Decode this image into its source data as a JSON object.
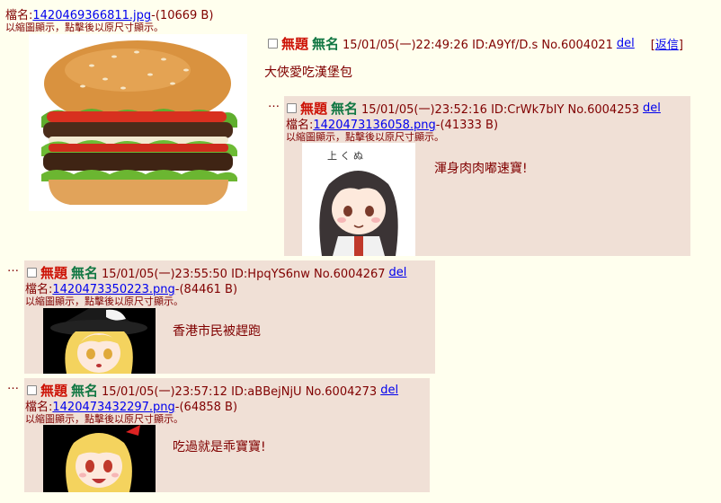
{
  "op": {
    "file_label": "檔名:",
    "file_name": "1420469366811.jpg",
    "file_size": "-(10669 B)",
    "hint": "以縮圖顯示，點擊後以原尺寸顯示。",
    "title": "無題",
    "name": "無名",
    "meta": "15/01/05(一)22:49:26 ID:A9Yf/D.s No.6004021",
    "del": "del",
    "reply_link": "返信",
    "reply_bracket_open": "[",
    "reply_bracket_close": "]",
    "body": "大俠愛吃漢堡包",
    "thumb_icon": "hamburger-image"
  },
  "replies": [
    {
      "dots": "…",
      "title": "無題",
      "name": "無名",
      "meta": "15/01/05(一)23:52:16 ID:CrWk7bIY No.6004253",
      "del": "del",
      "file_label": "檔名:",
      "file_name": "1420473136058.png",
      "file_size": "-(41333 B)",
      "hint": "以縮圖顯示，點擊後以原尺寸顯示。",
      "body": "渾身肉肉嘟速寶!",
      "thumb_caption": "上 く ぬ",
      "thumb_icon": "anime-girl-black-hair-image"
    },
    {
      "dots": "…",
      "title": "無題",
      "name": "無名",
      "meta": "15/01/05(一)23:55:50 ID:HpqYS6nw No.6004267",
      "del": "del",
      "file_label": "檔名:",
      "file_name": "1420473350223.png",
      "file_size": "-(84461 B)",
      "hint": "以縮圖顯示，點擊後以原尺寸顯示。",
      "body": "香港市民被趕跑",
      "thumb_icon": "anime-witch-blonde-image"
    },
    {
      "dots": "…",
      "title": "無題",
      "name": "無名",
      "meta": "15/01/05(一)23:57:12 ID:aBBejNjU No.6004273",
      "del": "del",
      "file_label": "檔名:",
      "file_name": "1420473432297.png",
      "file_size": "-(64858 B)",
      "hint": "以縮圖顯示，點擊後以原尺寸顯示。",
      "body": "吃過就是乖寶寶!",
      "thumb_icon": "anime-blonde-girl-image"
    }
  ],
  "colors": {
    "background": "#ffffee",
    "reply_background": "#f0e0d6",
    "title": "#cc1105",
    "name": "#117743",
    "text": "#800000",
    "link": "#0000ee"
  }
}
